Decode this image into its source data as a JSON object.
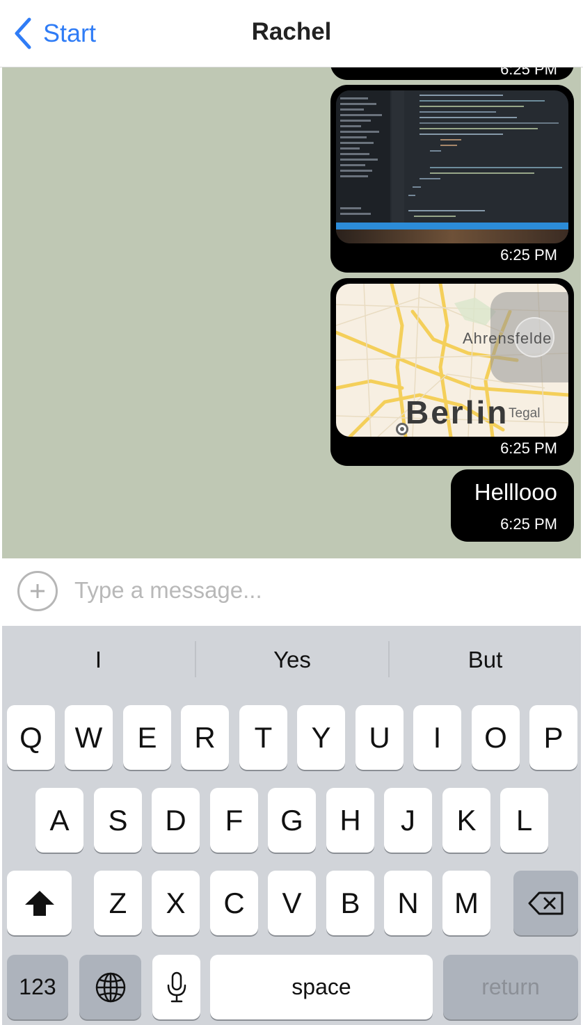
{
  "nav": {
    "back_label": "Start",
    "title": "Rachel"
  },
  "messages": [
    {
      "type": "partial",
      "time": "6:25 PM"
    },
    {
      "type": "image",
      "time": "6:25 PM"
    },
    {
      "type": "map",
      "time": "6:25 PM",
      "map_labels": {
        "city": "Berlin",
        "area": "Ahrensfelde",
        "district": "Tegal"
      }
    },
    {
      "type": "text",
      "text": "Helllooo",
      "time": "6:25 PM"
    }
  ],
  "composer": {
    "placeholder": "Type a message..."
  },
  "keyboard": {
    "suggestions": [
      "I",
      "Yes",
      "But"
    ],
    "row1": [
      "Q",
      "W",
      "E",
      "R",
      "T",
      "Y",
      "U",
      "I",
      "O",
      "P"
    ],
    "row2": [
      "A",
      "S",
      "D",
      "F",
      "G",
      "H",
      "J",
      "K",
      "L"
    ],
    "row3": [
      "Z",
      "X",
      "C",
      "V",
      "B",
      "N",
      "M"
    ],
    "numbers_label": "123",
    "space_label": "space",
    "return_label": "return"
  },
  "colors": {
    "accent": "#2f7cf6",
    "chat_background": "#bfc8b4",
    "bubble": "#000000",
    "keyboard": "#d1d4d9"
  }
}
